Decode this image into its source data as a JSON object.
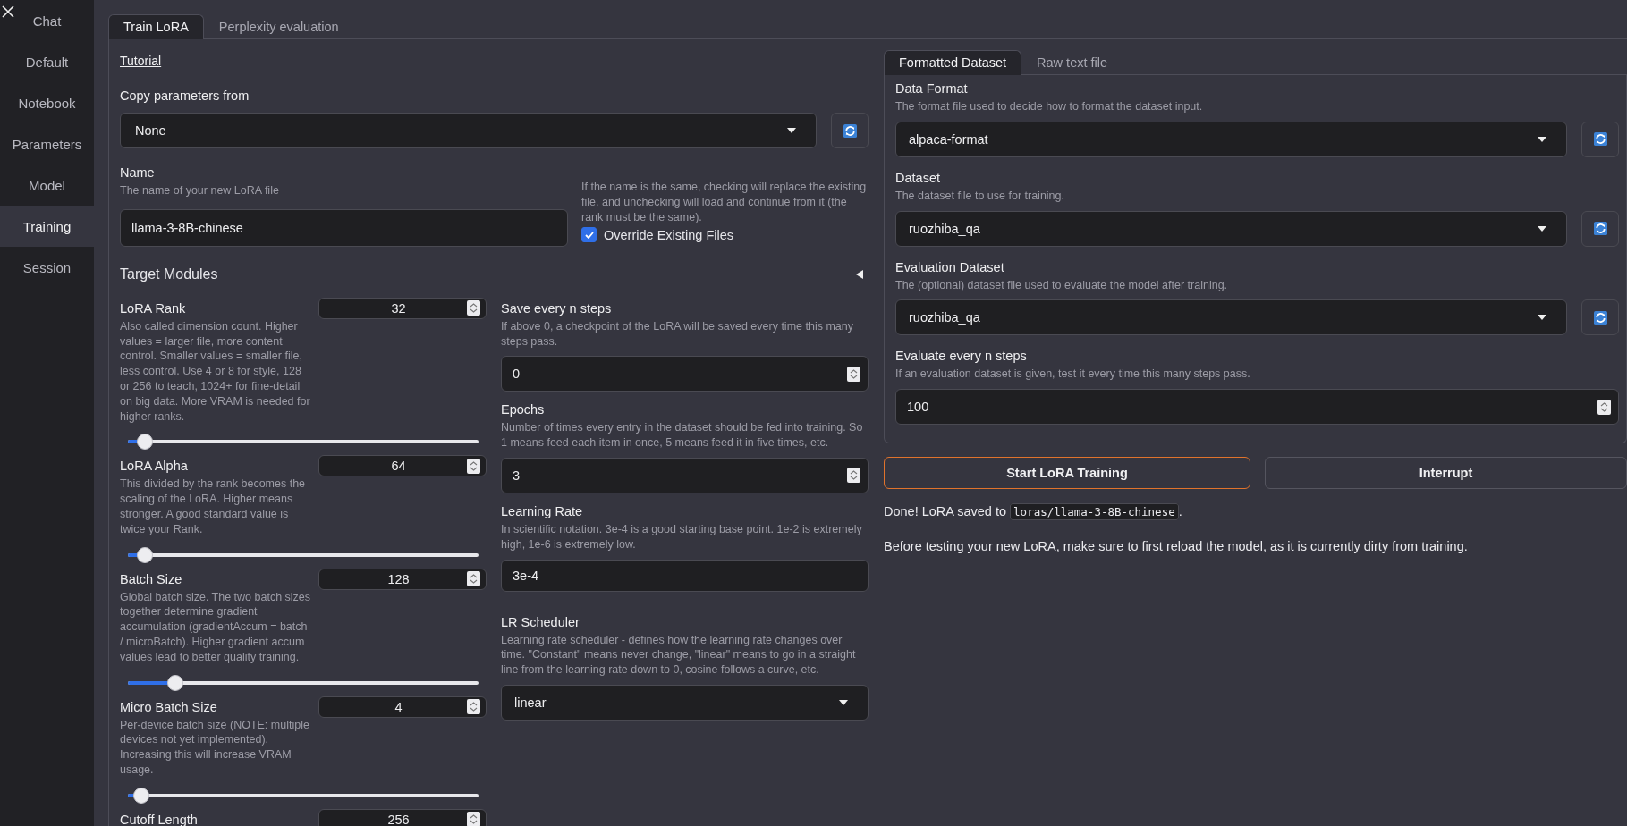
{
  "sidebar": {
    "items": [
      {
        "label": "Chat",
        "selected": false
      },
      {
        "label": "Default",
        "selected": false
      },
      {
        "label": "Notebook",
        "selected": false
      },
      {
        "label": "Parameters",
        "selected": false
      },
      {
        "label": "Model",
        "selected": false
      },
      {
        "label": "Training",
        "selected": true
      },
      {
        "label": "Session",
        "selected": false
      }
    ]
  },
  "tabs": [
    {
      "label": "Train LoRA",
      "selected": true
    },
    {
      "label": "Perplexity evaluation",
      "selected": false
    }
  ],
  "tutorial_link": "Tutorial",
  "copy_parameters": {
    "label": "Copy parameters from",
    "value": "None"
  },
  "name": {
    "label": "Name",
    "description": "The name of your new LoRA file",
    "value": "llama-3-8B-chinese"
  },
  "override": {
    "description": "If the name is the same, checking will replace the existing file, and unchecking will load and continue from it (the rank must be the same).",
    "label": "Override Existing Files",
    "checked": true
  },
  "target_modules": {
    "label": "Target Modules",
    "expanded": false
  },
  "sliders": [
    {
      "label": "LoRA Rank",
      "description": "Also called dimension count. Higher values = larger file, more content control. Smaller values = smaller file, less control. Use 4 or 8 for style, 128 or 256 to teach, 1024+ for fine-detail on big data. More VRAM is needed for higher ranks.",
      "value": "32",
      "level": 0.048
    },
    {
      "label": "LoRA Alpha",
      "description": "This divided by the rank becomes the scaling of the LoRA. Higher means stronger. A good standard value is twice your Rank.",
      "value": "64",
      "level": 0.048
    },
    {
      "label": "Batch Size",
      "description": "Global batch size. The two batch sizes together determine gradient accumulation (gradientAccum = batch / microBatch). Higher gradient accum values lead to better quality training.",
      "value": "128",
      "level": 0.136
    },
    {
      "label": "Micro Batch Size",
      "description": "Per-device batch size (NOTE: multiple devices not yet implemented). Increasing this will increase VRAM usage.",
      "value": "4",
      "level": 0.037
    },
    {
      "label": "Cutoff Length",
      "value": "256"
    }
  ],
  "middle_fields": [
    {
      "kind": "number",
      "label": "Save every n steps",
      "description": "If above 0, a checkpoint of the LoRA will be saved every time this many steps pass.",
      "value": "0"
    },
    {
      "kind": "number",
      "label": "Epochs",
      "description": "Number of times every entry in the dataset should be fed into training. So 1 means feed each item in once, 5 means feed it in five times, etc.",
      "value": "3"
    },
    {
      "kind": "text",
      "label": "Learning Rate",
      "description": "In scientific notation. 3e-4 is a good starting base point. 1e-2 is extremely high, 1e-6 is extremely low.",
      "value": "3e-4"
    },
    {
      "kind": "dropdown",
      "label": "LR Scheduler",
      "description": "Learning rate scheduler - defines how the learning rate changes over time. \"Constant\" means never change, \"linear\" means to go in a straight line from the learning rate down to 0, cosine follows a curve, etc.",
      "value": "linear"
    }
  ],
  "dataset_tabs": [
    {
      "label": "Formatted Dataset",
      "selected": true
    },
    {
      "label": "Raw text file",
      "selected": false
    }
  ],
  "dataset_fields": [
    {
      "kind": "dropdown",
      "label": "Data Format",
      "description": "The format file used to decide how to format the dataset input.",
      "value": "alpaca-format"
    },
    {
      "kind": "dropdown",
      "label": "Dataset",
      "description": "The dataset file to use for training.",
      "value": "ruozhiba_qa"
    },
    {
      "kind": "dropdown",
      "label": "Evaluation Dataset",
      "description": "The (optional) dataset file used to evaluate the model after training.",
      "value": "ruozhiba_qa"
    },
    {
      "kind": "number",
      "label": "Evaluate every n steps",
      "description": "If an evaluation dataset is given, test it every time this many steps pass.",
      "value": "100"
    }
  ],
  "buttons": [
    {
      "label": "Start LoRA Training",
      "primary": true
    },
    {
      "label": "Interrupt",
      "primary": false
    }
  ],
  "result": {
    "text": "Done! LoRA saved to",
    "path": "loras/llama-3-8B-chinese",
    "end": "."
  },
  "notice": "Before testing your new LoRA, make sure to first reload the model, as it is currently dirty from training."
}
